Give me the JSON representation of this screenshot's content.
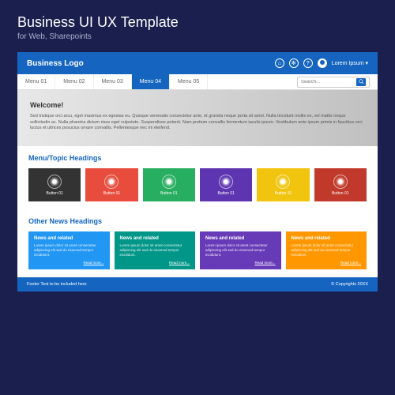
{
  "page": {
    "title": "Business UI UX Template",
    "subtitle": "for Web, Sharepoints"
  },
  "header": {
    "logo": "Business Logo",
    "user_label": "Lorem Ipsum ▾"
  },
  "nav": {
    "items": [
      "Menu 01",
      "Menu 02",
      "Menu 03",
      "Menu 04",
      "Menu 05"
    ],
    "active_index": 3,
    "search_placeholder": "Search..."
  },
  "hero": {
    "title": "Welcome!",
    "text": "Sed tristique orci arcu, eget maximus ex egestas eu. Quisque venenatis consectetur ante, et gravida neque porta sit amet. Nulla tincidunt mollis ex, vel mattis neque sollicitudin ac. Nulla pharetra dictum risus eget vulputate. Suspendisse potenti. Nam pretium convallis fermentum iaculis ipsum. Vestibulum ante ipsum primis in faucibus orci luctus et ultrices posucius ornare convallis. Pellentesque nec mi eleifend."
  },
  "sections": {
    "topics_title": "Menu/Topic Headings",
    "news_title": "Other News Headings"
  },
  "tiles": [
    {
      "label": "Button 01",
      "color": "#333333"
    },
    {
      "label": "Button 01",
      "color": "#e74c3c"
    },
    {
      "label": "Button 01",
      "color": "#27ae60"
    },
    {
      "label": "Button 01",
      "color": "#5e35b1"
    },
    {
      "label": "Button 01",
      "color": "#f1c40f"
    },
    {
      "label": "Button 01",
      "color": "#c0392b"
    }
  ],
  "cards": [
    {
      "title": "News and related",
      "text": "Lorem ipsum dolor sit amet consectetur adipiscing elit sed do eiusmod tempor incididunt.",
      "link": "Read more...",
      "color": "#2196f3"
    },
    {
      "title": "News and related",
      "text": "Lorem ipsum dolor sit amet consectetur adipiscing elit sed do eiusmod tempor incididunt.",
      "link": "Read more...",
      "color": "#009688"
    },
    {
      "title": "News and related",
      "text": "Lorem ipsum dolor sit amet consectetur adipiscing elit sed do eiusmod tempor incididunt.",
      "link": "Read more...",
      "color": "#673ab7"
    },
    {
      "title": "News and related",
      "text": "Lorem ipsum dolor sit amet consectetur adipiscing elit sed do eiusmod tempor incididunt.",
      "link": "Read more...",
      "color": "#ff9800"
    }
  ],
  "footer": {
    "left": "Footer Text to be included here",
    "right": "© Copyrights 20XX"
  }
}
